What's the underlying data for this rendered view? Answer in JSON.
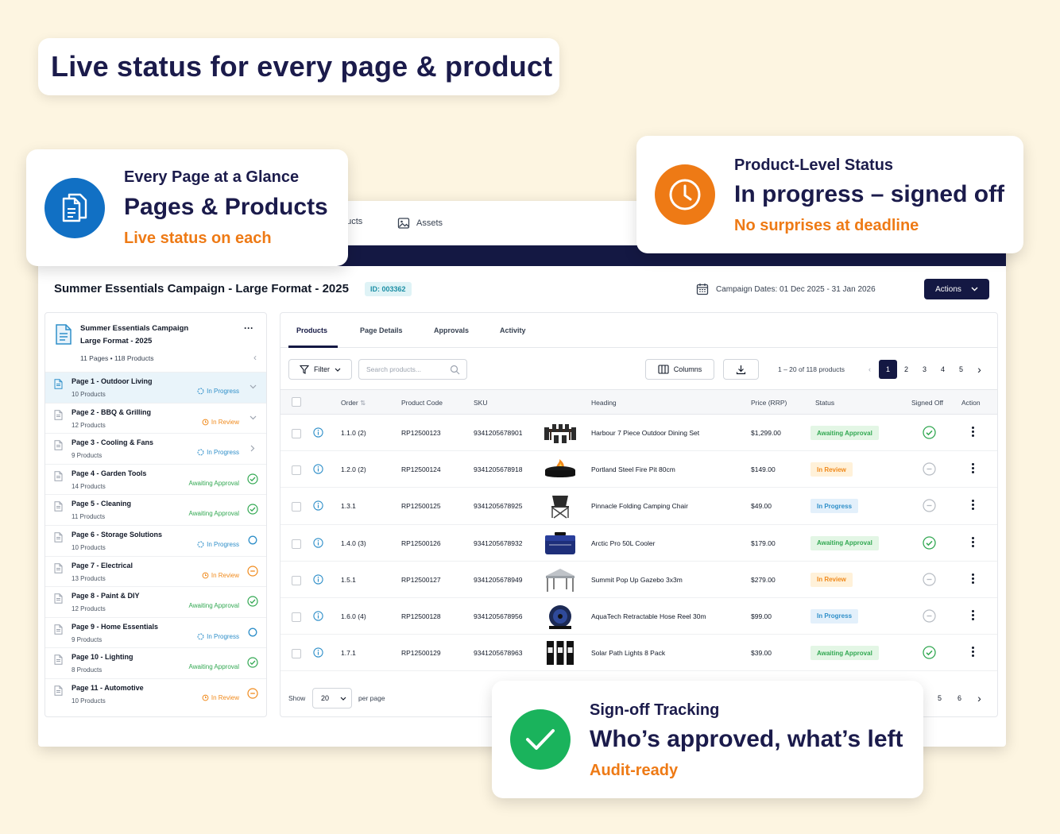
{
  "headline": "Live status for every page & product",
  "colors": {
    "navy": "#141843",
    "orange": "#ee7a15",
    "green": "#1ab35c",
    "blue": "#1170c4",
    "awaiting": "#32a852",
    "review": "#f08a1c",
    "progress": "#2f8fc9"
  },
  "topnav": {
    "products_partial": "ducts",
    "assets": "Assets",
    "assets_icon": "image-icon"
  },
  "campaign": {
    "title": "Summer Essentials Campaign - Large Format - 2025",
    "id": "ID: 003362",
    "dates": "Campaign Dates: 01 Dec 2025 - 31 Jan 2026",
    "actions": "Actions"
  },
  "sidebar": {
    "title_line1": "Summer Essentials Campaign",
    "title_line2": "Large Format - 2025",
    "meta": "11 Pages  •  118 Products",
    "pages": [
      {
        "name": "Page 1 - Outdoor Living",
        "count": "10 Products",
        "status": "In Progress",
        "kind": "progress",
        "end": "chevron-down",
        "active": true
      },
      {
        "name": "Page 2 - BBQ & Grilling",
        "count": "12 Products",
        "status": "In Review",
        "kind": "review",
        "end": "chevron-down"
      },
      {
        "name": "Page 3 - Cooling & Fans",
        "count": "9 Products",
        "status": "In Progress",
        "kind": "progress",
        "end": "chevron-right"
      },
      {
        "name": "Page 4 - Garden Tools",
        "count": "14 Products",
        "status": "Awaiting Approval",
        "kind": "awaiting",
        "end": "check"
      },
      {
        "name": "Page 5 - Cleaning",
        "count": "11 Products",
        "status": "Awaiting Approval",
        "kind": "awaiting",
        "end": "check"
      },
      {
        "name": "Page 6 - Storage Solutions",
        "count": "10 Products",
        "status": "In Progress",
        "kind": "progress",
        "end": "ring"
      },
      {
        "name": "Page 7 - Electrical",
        "count": "13 Products",
        "status": "In Review",
        "kind": "review",
        "end": "minus"
      },
      {
        "name": "Page 8 - Paint & DIY",
        "count": "12 Products",
        "status": "Awaiting Approval",
        "kind": "awaiting",
        "end": "check"
      },
      {
        "name": "Page 9 - Home Essentials",
        "count": "9 Products",
        "status": "In Progress",
        "kind": "progress",
        "end": "ring"
      },
      {
        "name": "Page 10 - Lighting",
        "count": "8 Products",
        "status": "Awaiting Approval",
        "kind": "awaiting",
        "end": "check"
      },
      {
        "name": "Page 11 - Automotive",
        "count": "10 Products",
        "status": "In Review",
        "kind": "review",
        "end": "minus"
      }
    ]
  },
  "tabs": [
    "Products",
    "Page Details",
    "Approvals",
    "Activity"
  ],
  "toolbar": {
    "filter": "Filter",
    "search_placeholder": "Search products...",
    "columns": "Columns",
    "range": "1 – 20 of 118 products",
    "pages": [
      "1",
      "2",
      "3",
      "4",
      "5"
    ],
    "current_page": "1"
  },
  "table": {
    "headers": {
      "order": "Order",
      "code": "Product Code",
      "sku": "SKU",
      "heading": "Heading",
      "price": "Price (RRP)",
      "status": "Status",
      "signed": "Signed Off",
      "action": "Action"
    },
    "rows": [
      {
        "order": "1.1.0 (2)",
        "code": "RP12500123",
        "sku": "9341205678901",
        "image": "dining-set",
        "heading": "Harbour 7 Piece Outdoor Dining Set",
        "price": "$1,299.00",
        "status": "Awaiting Approval",
        "kind": "awaiting",
        "signed": true
      },
      {
        "order": "1.2.0 (2)",
        "code": "RP12500124",
        "sku": "9341205678918",
        "image": "fire-pit",
        "heading": "Portland Steel Fire Pit 80cm",
        "price": "$149.00",
        "status": "In Review",
        "kind": "review",
        "signed": false
      },
      {
        "order": "1.3.1",
        "code": "RP12500125",
        "sku": "9341205678925",
        "image": "camping-chair",
        "heading": "Pinnacle Folding Camping Chair",
        "price": "$49.00",
        "status": "In Progress",
        "kind": "progress",
        "signed": false
      },
      {
        "order": "1.4.0 (3)",
        "code": "RP12500126",
        "sku": "9341205678932",
        "image": "cooler",
        "heading": "Arctic Pro 50L Cooler",
        "price": "$179.00",
        "status": "Awaiting Approval",
        "kind": "awaiting",
        "signed": true
      },
      {
        "order": "1.5.1",
        "code": "RP12500127",
        "sku": "9341205678949",
        "image": "gazebo",
        "heading": "Summit Pop Up Gazebo 3x3m",
        "price": "$279.00",
        "status": "In Review",
        "kind": "review",
        "signed": false
      },
      {
        "order": "1.6.0 (4)",
        "code": "RP12500128",
        "sku": "9341205678956",
        "image": "hose-reel",
        "heading": "AquaTech Retractable Hose Reel 30m",
        "price": "$99.00",
        "status": "In Progress",
        "kind": "progress",
        "signed": false
      },
      {
        "order": "1.7.1",
        "code": "RP12500129",
        "sku": "9341205678963",
        "image": "path-lights",
        "heading": "Solar Path Lights 8 Pack",
        "price": "$39.00",
        "status": "Awaiting Approval",
        "kind": "awaiting",
        "signed": true
      }
    ]
  },
  "footer": {
    "show": "Show",
    "per_page_value": "20",
    "per_page": "per page",
    "pages_visible": [
      "5",
      "6"
    ]
  },
  "callouts": {
    "pages": {
      "small": "Every Page at a Glance",
      "big": "Pages & Products",
      "orange": "Live status on each",
      "icon": "documents-icon"
    },
    "product": {
      "small": "Product-Level Status",
      "big": "In progress – signed off",
      "orange": "No surprises at deadline",
      "icon": "clock-icon"
    },
    "signoff": {
      "small": "Sign-off Tracking",
      "big": "Who’s approved, what’s left",
      "orange": "Audit-ready",
      "icon": "check-icon"
    }
  }
}
